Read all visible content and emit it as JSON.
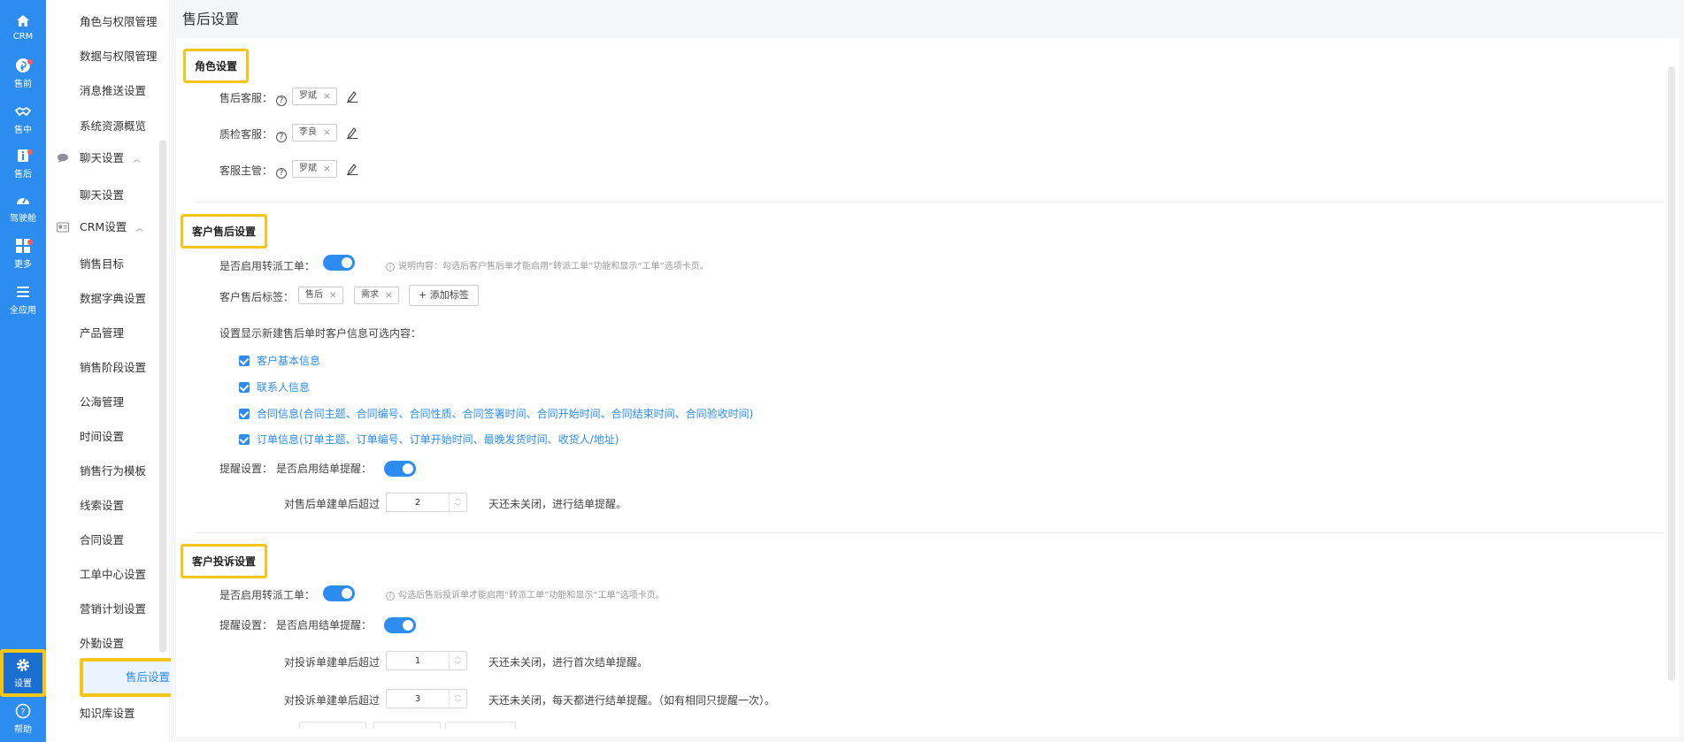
{
  "rail": {
    "items": [
      {
        "label": "CRM",
        "icon": "home-icon",
        "badge": false
      },
      {
        "label": "售前",
        "icon": "pinterest-icon",
        "badge": true
      },
      {
        "label": "售中",
        "icon": "handshake-icon",
        "badge": false
      },
      {
        "label": "售后",
        "icon": "info-icon",
        "badge": true
      },
      {
        "label": "驾驶舱",
        "icon": "dashboard-icon",
        "badge": false
      },
      {
        "label": "更多",
        "icon": "grid-icon",
        "badge": true
      },
      {
        "label": "全应用",
        "icon": "menu-icon",
        "badge": false
      },
      {
        "label": "设置",
        "icon": "gear-icon",
        "badge": false
      },
      {
        "label": "帮助",
        "icon": "help-icon",
        "badge": false
      }
    ]
  },
  "menu": {
    "items": [
      {
        "label": "角色与权限管理"
      },
      {
        "label": "数据与权限管理"
      },
      {
        "label": "消息推送设置"
      },
      {
        "label": "系统资源概览"
      },
      {
        "label": "聊天设置",
        "group": true
      },
      {
        "label": "聊天设置"
      },
      {
        "label": "CRM设置",
        "group": true
      },
      {
        "label": "销售目标"
      },
      {
        "label": "数据字典设置"
      },
      {
        "label": "产品管理"
      },
      {
        "label": "销售阶段设置"
      },
      {
        "label": "公海管理"
      },
      {
        "label": "时间设置"
      },
      {
        "label": "销售行为模板"
      },
      {
        "label": "线索设置"
      },
      {
        "label": "合同设置"
      },
      {
        "label": "工单中心设置"
      },
      {
        "label": "营销计划设置"
      },
      {
        "label": "外勤设置"
      },
      {
        "label": "售后设置",
        "active": true
      },
      {
        "label": "知识库设置"
      }
    ]
  },
  "page": {
    "title": "售后设置"
  },
  "role": {
    "title": "角色设置",
    "rows": [
      {
        "label": "售后客服：",
        "tag": "罗斌"
      },
      {
        "label": "质检客服：",
        "tag": "李良"
      },
      {
        "label": "客服主管：",
        "tag": "罗斌"
      }
    ]
  },
  "customer": {
    "title": "客户售后设置",
    "dispatch_label": "是否启用转派工单：",
    "dispatch_on": true,
    "dispatch_note": "说明内容：勾选后客户售后单才能启用“转派工单”功能和显示“工单”选项卡页。",
    "tags_label": "客户售后标签：",
    "tags": [
      "售后",
      "需求"
    ],
    "add_tag": "+ 添加标签",
    "display_label": "设置显示新建售后单时客户信息可选内容：",
    "options": [
      "客户基本信息",
      "联系人信息",
      "合同信息(合同主题、合同编号、合同性质、合同签署时间、合同开始时间、合同结束时间、合同验收时间)",
      "订单信息(订单主题、订单编号、订单开始时间、最晚发货时间、收货人/地址)"
    ],
    "remind_label": "提醒设置：",
    "remind_q": "是否启用结单提醒：",
    "remind_on": true,
    "remind_prefix": "对售后单建单后超过",
    "remind_days": "2",
    "remind_suffix": "天还未关闭，进行结单提醒。"
  },
  "complaint": {
    "title": "客户投诉设置",
    "dispatch_label": "是否启用转派工单：",
    "dispatch_on": true,
    "dispatch_note": "勾选后售后投诉单才能启用“转派工单”功能和显示“工单”选项卡页。",
    "remind_label": "提醒设置：",
    "remind_q": "是否启用结单提醒：",
    "remind_on": true,
    "first_prefix": "对投诉单建单后超过",
    "first_days": "1",
    "first_suffix": "天还未关闭，进行首次结单提醒。",
    "daily_prefix": "对投诉单建单后超过",
    "daily_days": "3",
    "daily_suffix": "天还未关闭，每天都进行结单提醒。（如有相同只提醒一次）。"
  },
  "colors": {
    "accent": "#2d8cf0",
    "highlight": "#f5c518"
  }
}
